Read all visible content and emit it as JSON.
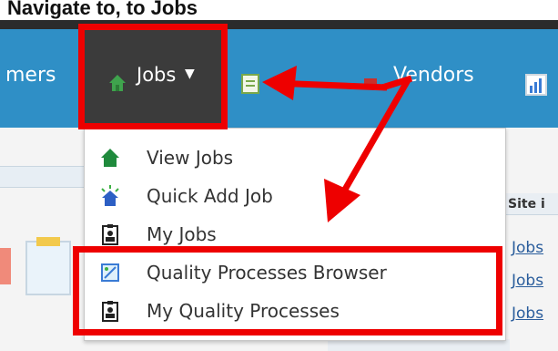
{
  "top_title": "Navigate to, to Jobs",
  "nav": {
    "customers_label": "mers",
    "jobs_label": "Jobs",
    "vendors_label": "Vendors"
  },
  "dropdown": {
    "items": [
      {
        "label": "View Jobs",
        "icon": "house-green-icon"
      },
      {
        "label": "Quick Add Job",
        "icon": "quick-add-house-icon"
      },
      {
        "label": "My Jobs",
        "icon": "badge-person-icon"
      },
      {
        "label": "Quality Processes Browser",
        "icon": "quality-browser-icon"
      },
      {
        "label": "My Quality Processes",
        "icon": "badge-person-icon"
      }
    ]
  },
  "right_panel": {
    "header": "Site i",
    "links": [
      "Jobs",
      "Jobs",
      "Jobs"
    ]
  },
  "colors": {
    "nav_blue": "#2f8fc6",
    "highlight_red": "#ee0000",
    "jobs_dark": "#3b3b3b"
  }
}
